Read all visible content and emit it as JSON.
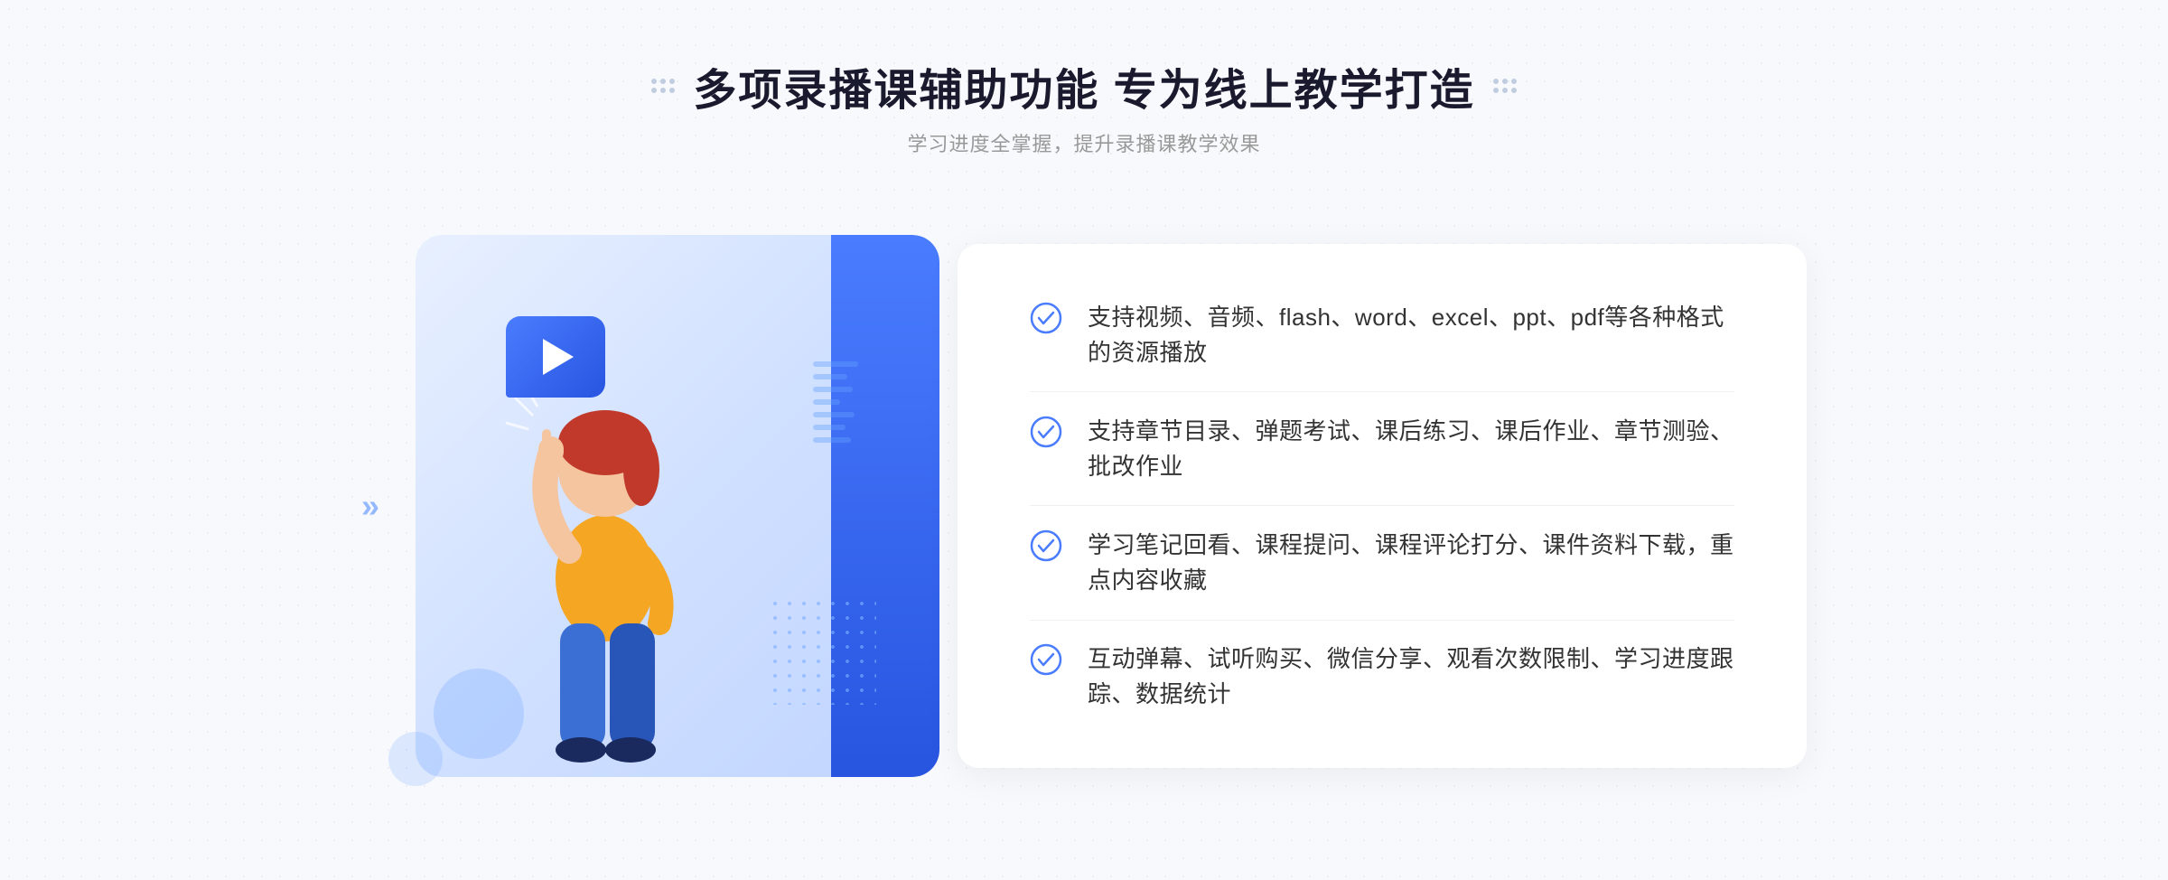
{
  "header": {
    "title": "多项录播课辅助功能 专为线上教学打造",
    "subtitle": "学习进度全掌握，提升录播课教学效果",
    "left_dots_label": "decorative-dots-left",
    "right_dots_label": "decorative-dots-right"
  },
  "features": [
    {
      "id": 1,
      "text": "支持视频、音频、flash、word、excel、ppt、pdf等各种格式的资源播放"
    },
    {
      "id": 2,
      "text": "支持章节目录、弹题考试、课后练习、课后作业、章节测验、批改作业"
    },
    {
      "id": 3,
      "text": "学习笔记回看、课程提问、课程评论打分、课件资料下载，重点内容收藏"
    },
    {
      "id": 4,
      "text": "互动弹幕、试听购买、微信分享、观看次数限制、学习进度跟踪、数据统计"
    }
  ],
  "illustration": {
    "alt": "online-learning-illustration"
  },
  "icons": {
    "check": "check-circle-icon",
    "play": "play-icon",
    "arrow_left": "«"
  }
}
